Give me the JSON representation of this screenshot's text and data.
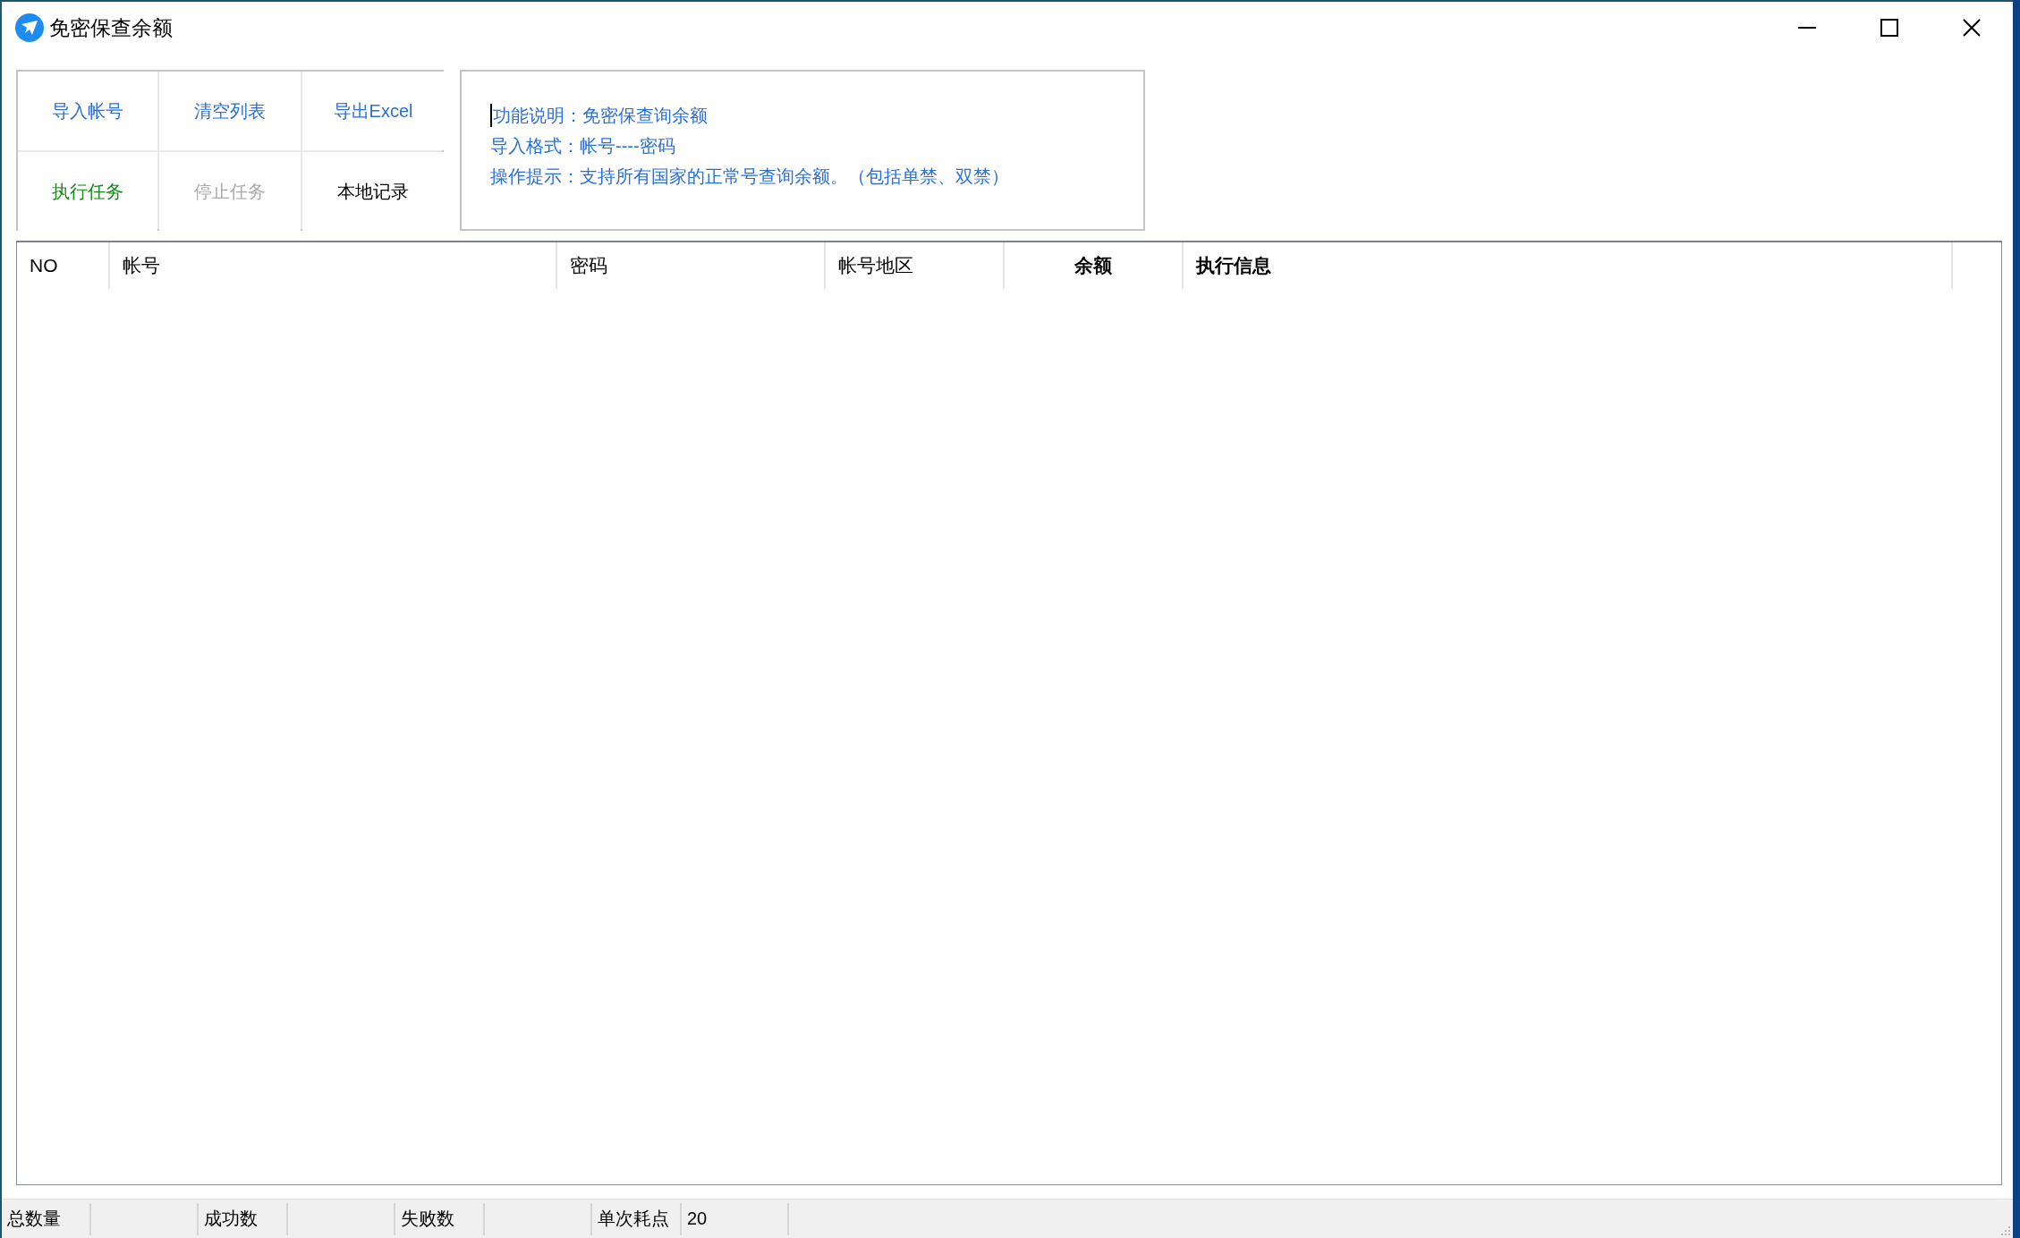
{
  "window": {
    "title": "免密保查余额"
  },
  "toolbar_buttons": [
    {
      "label": "导入帐号",
      "color": "#2a6fd6",
      "disabled": false
    },
    {
      "label": "清空列表",
      "color": "#2a6fd6",
      "disabled": false
    },
    {
      "label": "导出Excel",
      "color": "#2a6fd6",
      "disabled": false
    },
    {
      "label": "执行任务",
      "color": "#138a13",
      "disabled": false
    },
    {
      "label": "停止任务",
      "disabled": true
    },
    {
      "label": "本地记录",
      "color": "#000000",
      "disabled": false
    }
  ],
  "description": {
    "focused": true,
    "lines": [
      "功能说明：免密保查询余额",
      "导入格式：帐号----密码",
      "操作提示：支持所有国家的正常号查询余额。（包括单禁、双禁）"
    ]
  },
  "table": {
    "columns": [
      {
        "label": "NO",
        "kind": "plain"
      },
      {
        "label": "帐号",
        "kind": "plain"
      },
      {
        "label": "密码",
        "kind": "plain"
      },
      {
        "label": "帐号地区",
        "kind": "plain"
      },
      {
        "label": "余额",
        "kind": "centered-bold"
      },
      {
        "label": "执行信息",
        "kind": "bold"
      }
    ]
  },
  "status_bar": [
    {
      "label": "总数量"
    },
    {
      "label": "成功数"
    },
    {
      "label": "失败数"
    },
    {
      "label": "单次耗点",
      "value": "20"
    }
  ]
}
